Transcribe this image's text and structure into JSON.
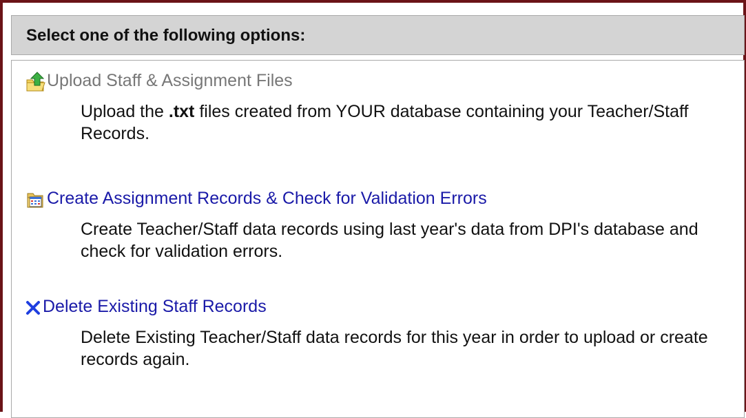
{
  "header": {
    "title": "Select one of the following options:"
  },
  "options": [
    {
      "title": "Upload Staff & Assignment Files",
      "icon": "upload-folder-icon",
      "desc_prefix": "Upload the ",
      "desc_bold": ".txt",
      "desc_suffix": " files created from YOUR database containing your Teacher/Staff Records."
    },
    {
      "title": "Create Assignment Records & Check for Validation Errors",
      "icon": "calendar-folder-icon",
      "desc": "Create Teacher/Staff data records using last year's data from DPI's database and check for validation errors."
    },
    {
      "title": "Delete Existing Staff Records",
      "icon": "delete-x-icon",
      "desc": "Delete Existing Teacher/Staff data records for this year in order to upload or create records again."
    }
  ],
  "colors": {
    "frame_border": "#6b1418",
    "header_bg": "#d4d4d4",
    "link": "#1a1aa8",
    "muted_link": "#777777",
    "delete_icon": "#1f3fe0"
  }
}
